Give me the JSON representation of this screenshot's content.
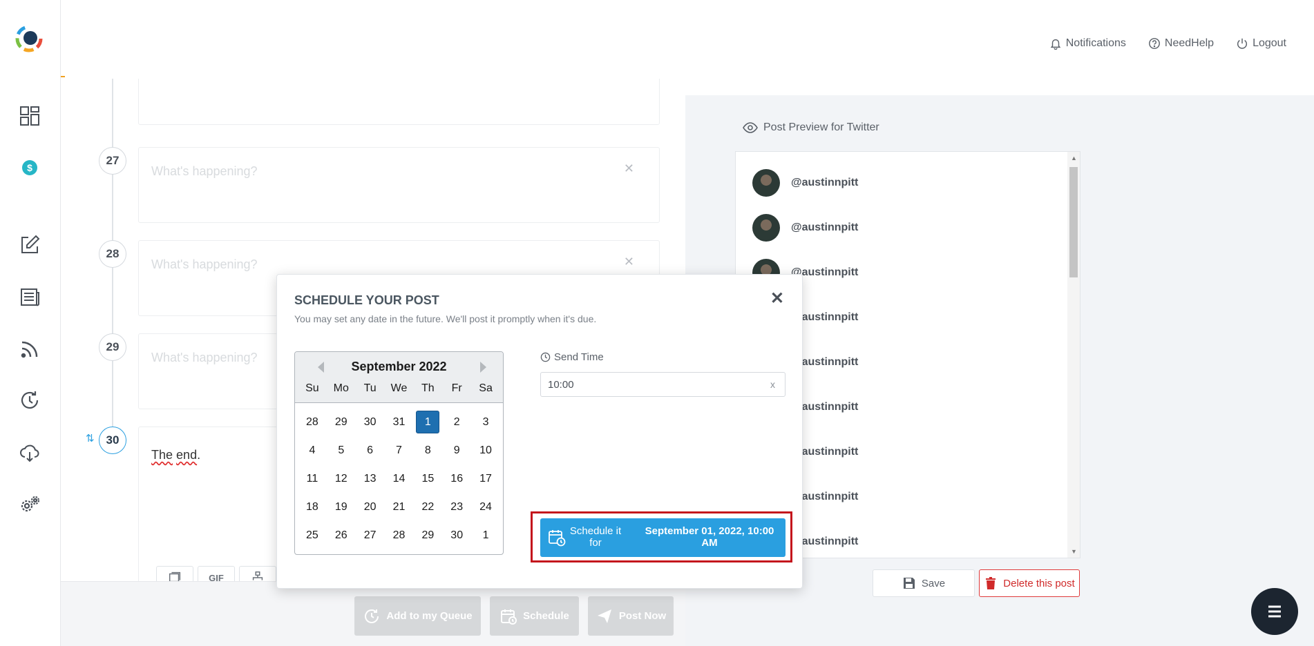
{
  "topbar": {
    "notifications": "Notifications",
    "need_help": "NeedHelp",
    "logout": "Logout"
  },
  "sidebar": {
    "items": [
      "dashboard-icon",
      "billing-icon",
      "compose-icon",
      "articles-icon",
      "rss-icon",
      "recycle-icon",
      "cloud-download-icon",
      "settings-icon"
    ]
  },
  "editor": {
    "threads": [
      {
        "number": "27",
        "placeholder": "What's happening?"
      },
      {
        "number": "28",
        "placeholder": "What's happening?"
      },
      {
        "number": "29",
        "placeholder": "What's happening?"
      },
      {
        "number": "30",
        "text_word1": "The",
        "text_word2": "end",
        "text_punct": "."
      }
    ],
    "media": {
      "gif": "GIF"
    },
    "actions": {
      "add_queue": "Add to my Queue",
      "schedule": "Schedule",
      "post_now": "Post Now"
    }
  },
  "preview": {
    "title": "Post Preview for Twitter",
    "handles": [
      "@austinnpitt",
      "@austinnpitt",
      "@austinnpitt",
      "@austinnpitt",
      "@austinnpitt",
      "@austinnpitt",
      "@austinnpitt",
      "@austinnpitt",
      "@austinnpitt"
    ],
    "save": "Save",
    "delete": "Delete this post"
  },
  "modal": {
    "title": "SCHEDULE YOUR POST",
    "subtitle": "You may set any date in the future. We'll post it promptly when it's due.",
    "calendar": {
      "month": "September 2022",
      "days_of_week": [
        "Su",
        "Mo",
        "Tu",
        "We",
        "Th",
        "Fr",
        "Sa"
      ],
      "weeks": [
        [
          "28",
          "29",
          "30",
          "31",
          "1",
          "2",
          "3"
        ],
        [
          "4",
          "5",
          "6",
          "7",
          "8",
          "9",
          "10"
        ],
        [
          "11",
          "12",
          "13",
          "14",
          "15",
          "16",
          "17"
        ],
        [
          "18",
          "19",
          "20",
          "21",
          "22",
          "23",
          "24"
        ],
        [
          "25",
          "26",
          "27",
          "28",
          "29",
          "30",
          "1"
        ]
      ],
      "selected": "1"
    },
    "send_time_label": "Send Time",
    "send_time_value": "10:00",
    "clear": "x",
    "schedule_button": {
      "left": "Schedule it for",
      "right": "September 01, 2022, 10:00 AM"
    }
  },
  "colors": {
    "accent": "#2a9fe0",
    "selected_day": "#1e6fb0",
    "danger": "#d02a2a",
    "highlight_outline": "#c4141c"
  }
}
